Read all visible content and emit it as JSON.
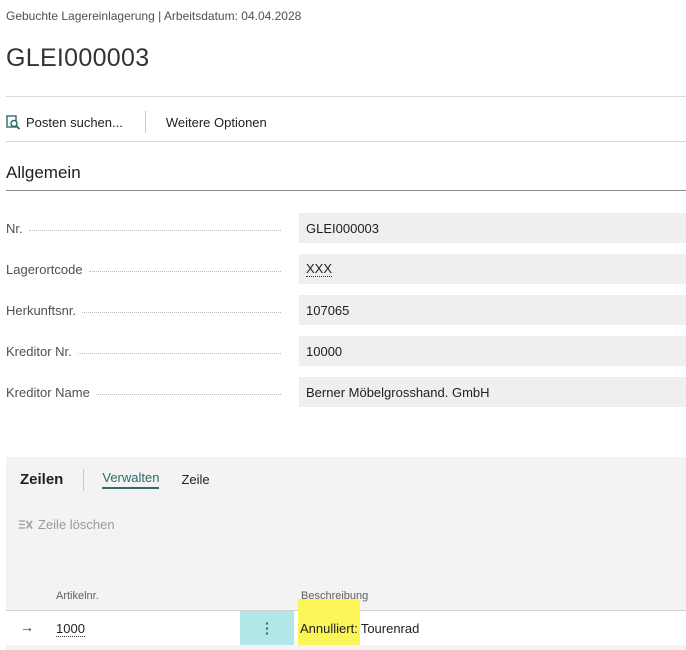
{
  "header": {
    "breadcrumb": "Gebuchte Lagereinlagerung | Arbeitsdatum: 04.04.2028",
    "title": "GLEI000003"
  },
  "toolbar": {
    "find_entries": "Posten suchen...",
    "more_options": "Weitere Optionen"
  },
  "general": {
    "title": "Allgemein",
    "fields": [
      {
        "label": "Nr.",
        "value": "GLEI000003"
      },
      {
        "label": "Lagerortcode",
        "value": "XXX"
      },
      {
        "label": "Herkunftsnr.",
        "value": "107065"
      },
      {
        "label": "Kreditor Nr.",
        "value": "10000"
      },
      {
        "label": "Kreditor Name",
        "value": "Berner Möbelgrosshand. GmbH"
      }
    ]
  },
  "lines": {
    "title": "Zeilen",
    "tabs": [
      "Verwalten",
      "Zeile"
    ],
    "delete_line": "Zeile löschen",
    "columns": [
      "Artikelnr.",
      "Beschreibung"
    ],
    "rows": [
      {
        "item_no": "1000",
        "desc_highlight": "Annulliert:",
        "desc_rest": "Tourenrad"
      }
    ]
  },
  "colors": {
    "accent": "#2e6b6a",
    "highlight": "#fbf55a",
    "row_menu": "#b2e7ea"
  }
}
